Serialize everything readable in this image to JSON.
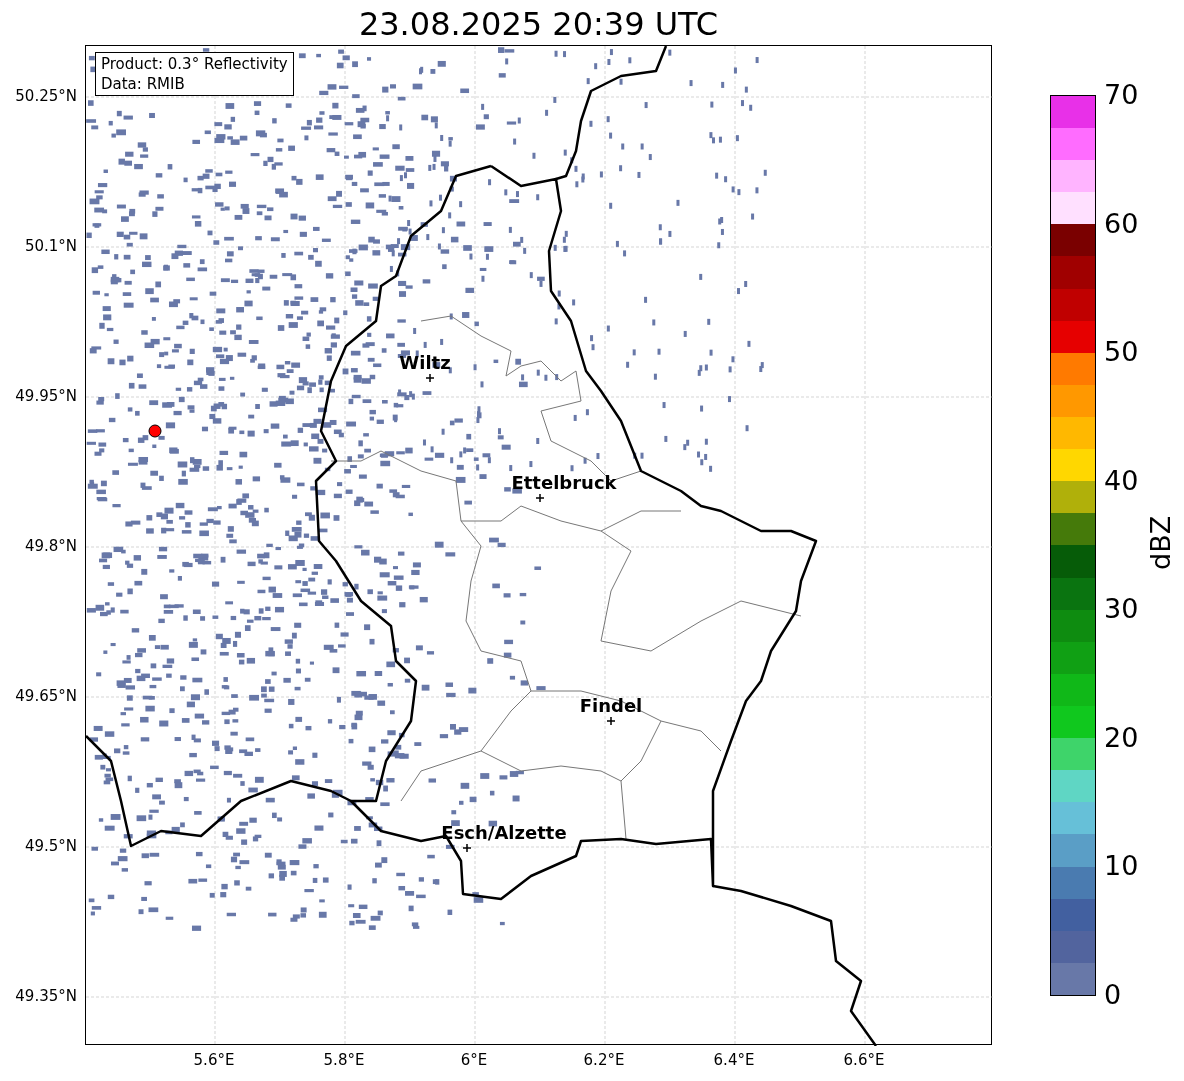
{
  "title": "23.08.2025 20:39 UTC",
  "info_box": {
    "lines": [
      "Product: 0.3° Reflectivity",
      "Data: RMIB"
    ]
  },
  "map": {
    "y_ticks": [
      "50.25°N",
      "50.1°N",
      "49.95°N",
      "49.8°N",
      "49.65°N",
      "49.5°N",
      "49.35°N"
    ],
    "x_ticks": [
      "5.6°E",
      "5.8°E",
      "6°E",
      "6.2°E",
      "6.4°E",
      "6.6°E"
    ],
    "places": [
      {
        "name": "Wiltz"
      },
      {
        "name": "Ettelbruck"
      },
      {
        "name": "Findel"
      },
      {
        "name": "Esch/Alzette"
      }
    ]
  },
  "colorbar": {
    "label": "dBZ",
    "ticks": [
      "70",
      "60",
      "50",
      "40",
      "30",
      "20",
      "10",
      "0"
    ],
    "bands": [
      {
        "color": "#6878a8"
      },
      {
        "color": "#52649e"
      },
      {
        "color": "#4260a0"
      },
      {
        "color": "#4a7bb0"
      },
      {
        "color": "#5a9ec6"
      },
      {
        "color": "#66c0d8"
      },
      {
        "color": "#5fd6c4"
      },
      {
        "color": "#3ed46a"
      },
      {
        "color": "#10c81e"
      },
      {
        "color": "#10b818"
      },
      {
        "color": "#10a014"
      },
      {
        "color": "#0e8c10"
      },
      {
        "color": "#0a7410"
      },
      {
        "color": "#065c08"
      },
      {
        "color": "#457a0a"
      },
      {
        "color": "#b0b00a"
      },
      {
        "color": "#ffd700"
      },
      {
        "color": "#ffb800"
      },
      {
        "color": "#ff9800"
      },
      {
        "color": "#ff7a00"
      },
      {
        "color": "#e60000"
      },
      {
        "color": "#c00000"
      },
      {
        "color": "#a00000"
      },
      {
        "color": "#7a0000"
      },
      {
        "color": "#ffe0ff"
      },
      {
        "color": "#ffb4ff"
      },
      {
        "color": "#ff6cff"
      },
      {
        "color": "#e830e8"
      }
    ]
  }
}
